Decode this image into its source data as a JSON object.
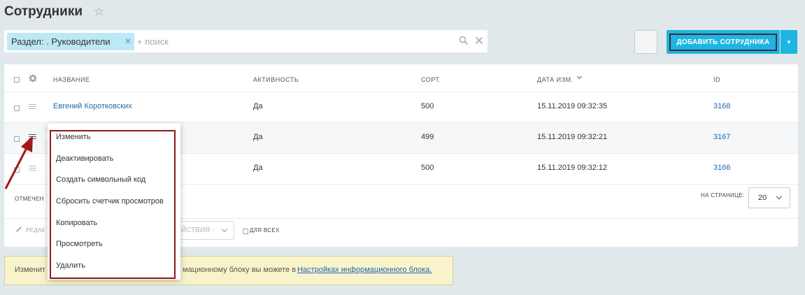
{
  "header": {
    "title": "Сотрудники",
    "favorite_icon": "star-icon"
  },
  "filter": {
    "chip_label": "Раздел: . Руководители",
    "search_placeholder": "+ поиск",
    "search_icon": "search-icon",
    "clear_icon": "close-icon"
  },
  "toolbar": {
    "add_label": "ДОБАВИТЬ СОТРУДНИКА",
    "accent_color": "#1eb5e3"
  },
  "table": {
    "columns": [
      "НАЗВАНИЕ",
      "АКТИВНОСТЬ",
      "СОРТ.",
      "ДАТА ИЗМ.",
      "ID"
    ],
    "rows": [
      {
        "name": "Евгений Коротковских",
        "active": "Да",
        "sort": "500",
        "date": "15.11.2019 09:32:35",
        "id": "3168"
      },
      {
        "name": "",
        "active": "Да",
        "sort": "499",
        "date": "15.11.2019 09:32:21",
        "id": "3167"
      },
      {
        "name": "",
        "active": "Да",
        "sort": "500",
        "date": "15.11.2019 09:32:12",
        "id": "3166"
      }
    ]
  },
  "footer": {
    "selected_label": "ОТМЕЧЕН",
    "per_page_label": "НА СТРАНИЦЕ:",
    "per_page_value": "20",
    "edit_label": "РЕДАК",
    "actions_label": "ЙСТВИЯ -",
    "for_all_label": "ДЛЯ ВСЕХ"
  },
  "notice": {
    "text_start": "Изменит",
    "text_middle": "мационному блоку вы можете в ",
    "link": "Настройках информационного блока."
  },
  "context_menu": {
    "items": [
      "Изменить",
      "Деактивировать",
      "Создать символьный код",
      "Сбросить счетчик просмотров",
      "Копировать",
      "Просмотреть",
      "Удалить"
    ]
  }
}
